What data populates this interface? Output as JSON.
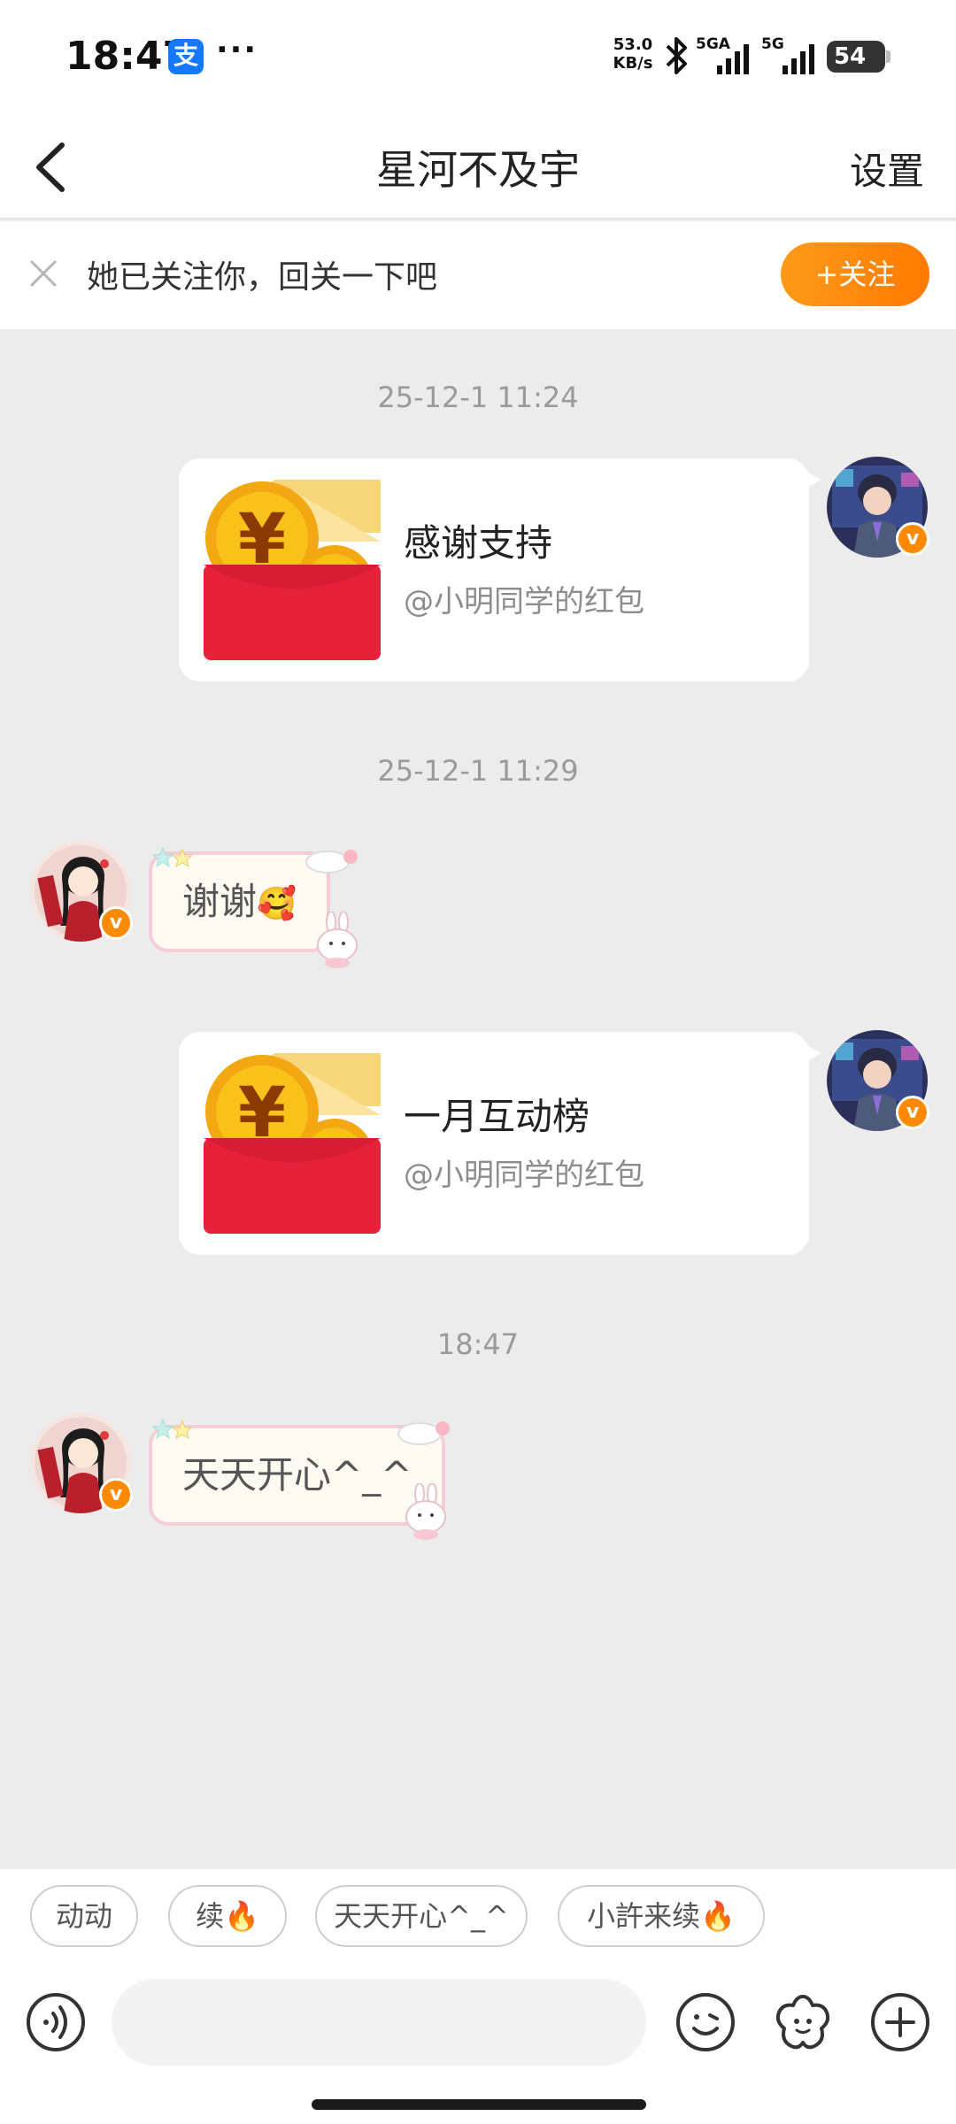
{
  "status_bar": {
    "time": "18:47",
    "app_icon_char": "支",
    "more": "···",
    "speed_value": "53.0",
    "speed_unit": "KB/s",
    "sim1_label": "5GA",
    "sim2_label": "5G",
    "battery": "54"
  },
  "header": {
    "title": "星河不及宇",
    "settings_label": "设置"
  },
  "banner": {
    "text": "她已关注你，回关一下吧",
    "follow_label": "+关注"
  },
  "messages": [
    {
      "timestamp": "25-12-1 11:24",
      "type": "red_packet",
      "from": "me",
      "title": "感谢支持",
      "subtitle": "@小明同学的红包"
    },
    {
      "timestamp": "25-12-1 11:29",
      "type": "text",
      "from": "other",
      "text": "谢谢",
      "emoji": "🥰"
    },
    {
      "type": "red_packet",
      "from": "me",
      "title": "一月互动榜",
      "subtitle": "@小明同学的红包"
    },
    {
      "timestamp": "18:47",
      "type": "text",
      "from": "other",
      "text": "天天开心^_^"
    }
  ],
  "quick_replies": [
    "动动",
    "续🔥",
    "天天开心^_^",
    "小許来续🔥"
  ],
  "input": {
    "placeholder": "",
    "value": ""
  },
  "icons": {
    "voice": "voice-icon",
    "emoji": "emoji-icon",
    "sticker": "sticker-icon",
    "plus": "plus-icon"
  },
  "colors": {
    "accent": "#ff8a00",
    "red_packet": "#e8213a",
    "bubble_border": "#f5cdd6"
  }
}
